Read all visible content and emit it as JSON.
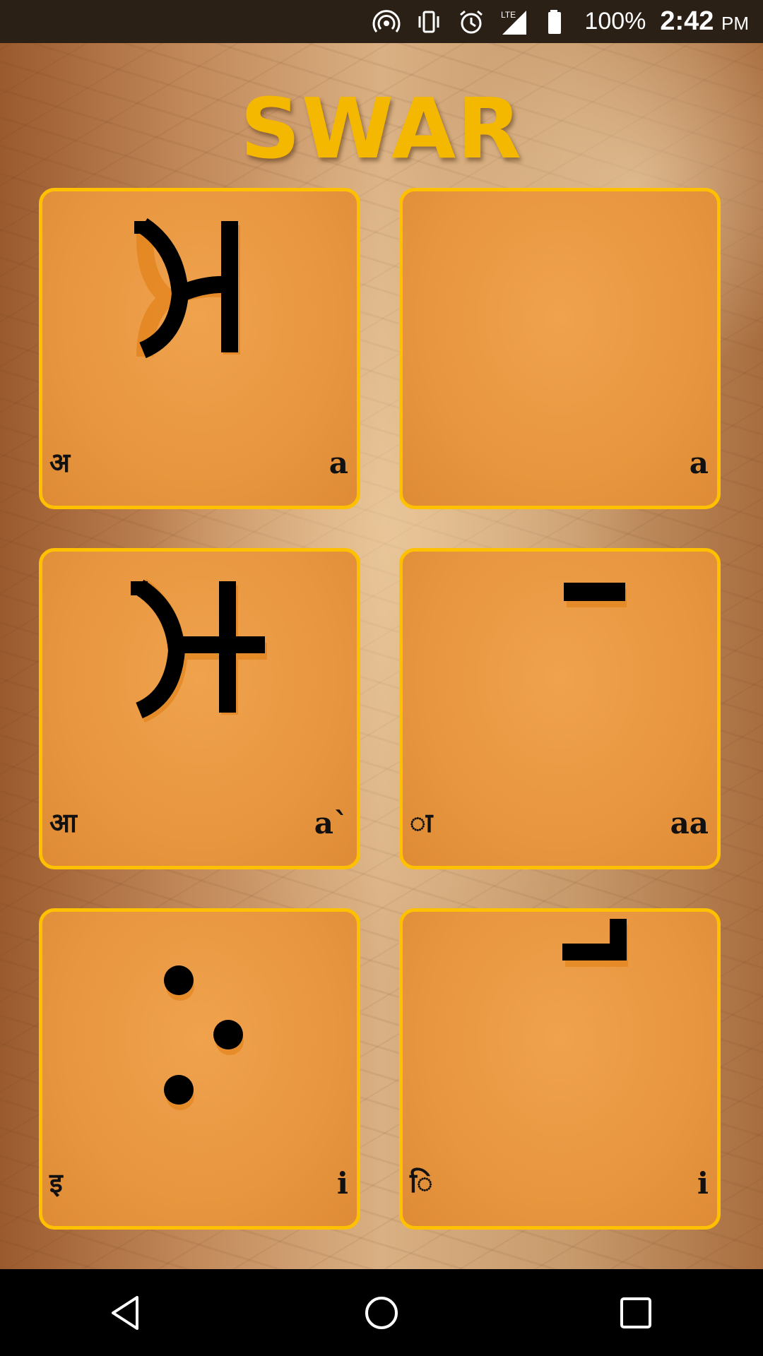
{
  "status_bar": {
    "battery": "100%",
    "time": "2:42",
    "ampm": "PM",
    "network": "LTE",
    "icons": [
      "hotspot-icon",
      "vibrate-icon",
      "alarm-icon",
      "lte-signal-icon",
      "battery-icon"
    ]
  },
  "title": "SWAR",
  "cards": [
    {
      "glyph": "brahmi-a",
      "hindi": "अ",
      "roman": "a"
    },
    {
      "glyph": "blank",
      "hindi": "",
      "roman": "a"
    },
    {
      "glyph": "brahmi-aa",
      "hindi": "आ",
      "roman": "a`"
    },
    {
      "glyph": "brahmi-aa-matra",
      "hindi": "ा",
      "roman": "aa"
    },
    {
      "glyph": "brahmi-i",
      "hindi": "इ",
      "roman": "i"
    },
    {
      "glyph": "brahmi-i-matra",
      "hindi": "ि",
      "roman": "i"
    }
  ],
  "nav": {
    "icons": [
      "back-icon",
      "home-icon",
      "recents-icon"
    ]
  },
  "colors": {
    "title": "#f4b800",
    "card_border": "#ffc000",
    "card_fill": "#e8963f",
    "glyph": "#000000"
  }
}
